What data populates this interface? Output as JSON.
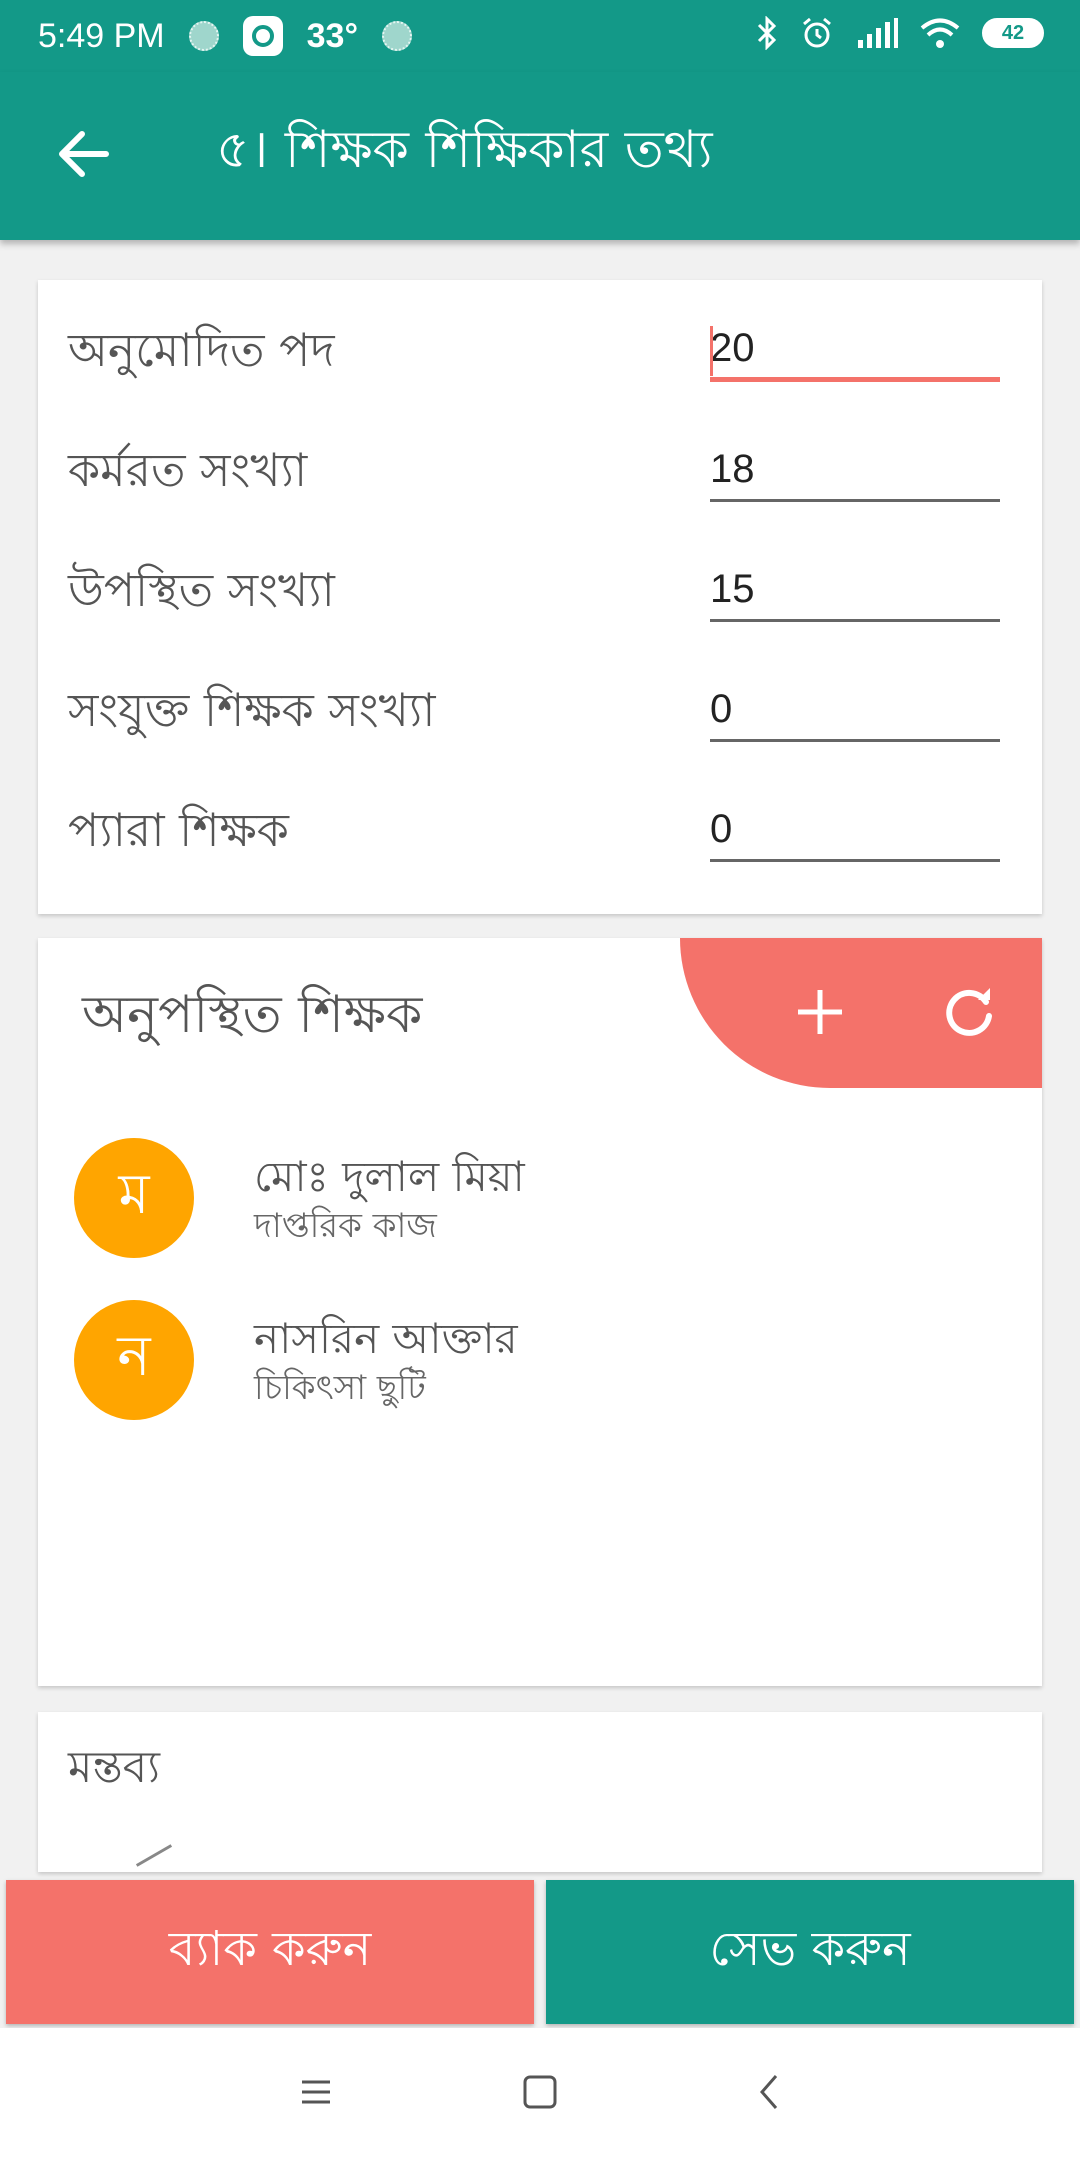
{
  "status_bar": {
    "time": "5:49 PM",
    "temperature": "33°",
    "battery": "42",
    "icons": [
      "loading-dot-icon",
      "weather-app-icon",
      "loading-dot-icon",
      "bluetooth-icon",
      "alarm-icon",
      "signal-icon",
      "wifi-icon",
      "battery-icon"
    ]
  },
  "app_bar": {
    "title": "৫। শিক্ষক শিক্ষিকার তথ্য",
    "back_icon": "arrow-back-icon"
  },
  "teacher_stats": [
    {
      "label": "অনুমোদিত পদ",
      "value": "20"
    },
    {
      "label": "কর্মরত সংখ্যা",
      "value": "18"
    },
    {
      "label": "উপস্থিত সংখ্যা",
      "value": "15"
    },
    {
      "label": "সংযুক্ত শিক্ষক সংখ্যা",
      "value": "0"
    },
    {
      "label": "প্যারা শিক্ষক",
      "value": "0"
    }
  ],
  "absent_section": {
    "title": "অনুপস্থিত শিক্ষক",
    "actions": [
      "add-icon",
      "refresh-icon"
    ],
    "teachers": [
      {
        "initial": "ম",
        "name": "মোঃ দুলাল মিয়া",
        "reason": "দাপ্তরিক কাজ"
      },
      {
        "initial": "ন",
        "name": "নাসরিন আক্তার",
        "reason": "চিকিৎসা ছুটি"
      }
    ]
  },
  "comment_section": {
    "title": "মন্তব্য"
  },
  "buttons": {
    "back": "ব্যাক করুন",
    "save": "সেভ করুন"
  },
  "colors": {
    "primary": "#139988",
    "accent": "#f4726a",
    "avatar": "#ffa500"
  },
  "nav_bar": [
    "menu-icon",
    "home-icon",
    "back-icon"
  ]
}
